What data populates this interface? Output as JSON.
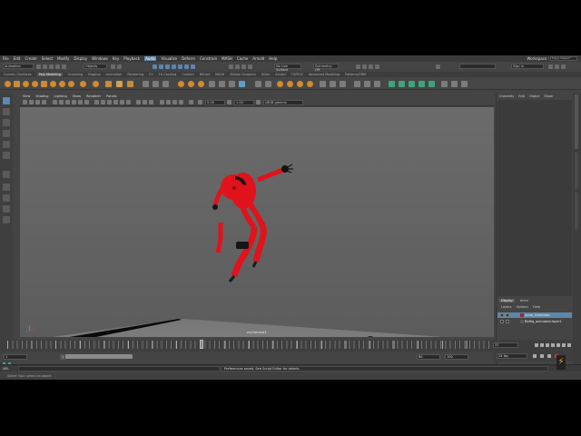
{
  "menubar": {
    "items": [
      "File",
      "Edit",
      "Create",
      "Select",
      "Modify",
      "Display",
      "Windows",
      "Key",
      "Playback",
      "Audio",
      "Visualize",
      "Deform",
      "Constrain",
      "MASH",
      "Cache",
      "Arnold",
      "Help"
    ],
    "active_index": 9,
    "workspace_label": "Workspace :",
    "workspace_value": "Maya Classic*"
  },
  "statusline": {
    "mode_dropdown": "Animation",
    "selection_mode": "Objects",
    "live_surface": "No Live Surface",
    "symmetry": "Symmetry: Off",
    "signin": "Sign in"
  },
  "shelf": {
    "tabs": [
      "Curves / Surfaces",
      "Poly Modeling",
      "Sculpting",
      "Rigging",
      "Animation",
      "Rendering",
      "FX",
      "FX Caching",
      "Custom",
      "Bifrost",
      "MASH",
      "Motion Graphics",
      "XGen",
      "Arnold",
      "TURTLE",
      "Advanced Modeling",
      "Patterns/FBIK"
    ],
    "active_index": 1
  },
  "viewport": {
    "menu": [
      "View",
      "Shading",
      "Lighting",
      "Show",
      "Renderer",
      "Panels"
    ],
    "field_value_1": "0.00",
    "field_value_2": "1.00",
    "color_space": "sRGB gamma",
    "camera_label": "myCamera1"
  },
  "channel_box": {
    "tabs": [
      "Channels",
      "Edit",
      "Object",
      "Show"
    ]
  },
  "layer_editor": {
    "tabs": [
      "Display",
      "Anim"
    ],
    "active_tab": 0,
    "menu": [
      "Layers",
      "Options",
      "Help"
    ],
    "layers": [
      {
        "v": "V",
        "p": "P",
        "name": "Anim_Overrides",
        "color": "#8a2d2d",
        "selected": true
      },
      {
        "v": "V",
        "p": "P",
        "name": "BbRig_animated:layer1",
        "color": "#5a5a5a",
        "selected": false
      }
    ]
  },
  "timeslider": {
    "current_frame": "37",
    "start_field": "1",
    "range_start": "1",
    "range_end": "60",
    "end_field": "60",
    "anim_end": "100",
    "fps": "24 fps"
  },
  "commandline": {
    "label": "MEL",
    "result": "Preferences saved. See Script Editor for details."
  },
  "helpline": {
    "text": "Select Tool: select an object"
  },
  "colors": {
    "accent": "#5a86b0",
    "maya_logo": "#1fb3b3",
    "character": "#e0131c"
  }
}
